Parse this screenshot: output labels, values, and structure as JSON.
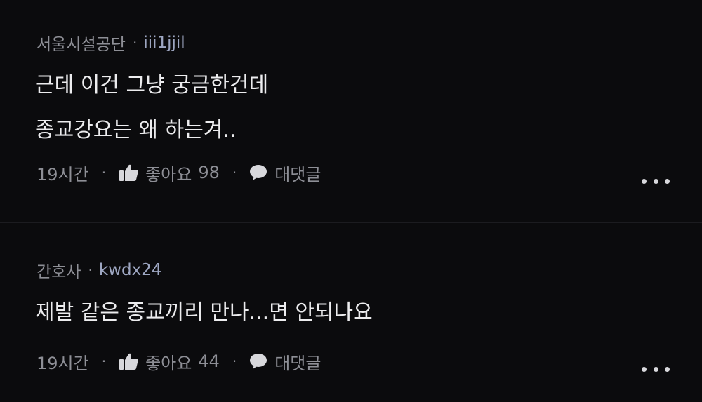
{
  "comments": [
    {
      "author": "서울시설공단",
      "separator": "·",
      "handle": "iii1jjil",
      "lines": [
        "근데 이건 그냥 궁금한건데",
        "종교강요는 왜 하는겨.."
      ],
      "time": "19시간",
      "like_label": "좋아요",
      "like_count": "98",
      "reply_label": "대댓글"
    },
    {
      "author": "간호사",
      "separator": "·",
      "handle": "kwdx24",
      "lines": [
        "제발 같은 종교끼리 만나...면 안되나요"
      ],
      "time": "19시간",
      "like_label": "좋아요",
      "like_count": "44",
      "reply_label": "대댓글"
    }
  ],
  "dot": "·",
  "icons": {
    "like": "thumbs-up-icon",
    "reply": "speech-bubble-icon",
    "more": "more-horizontal-icon"
  },
  "colors": {
    "background": "#0b0b0d",
    "text": "#ececee",
    "muted": "#8e8f96",
    "handle": "#9ea7c2"
  }
}
